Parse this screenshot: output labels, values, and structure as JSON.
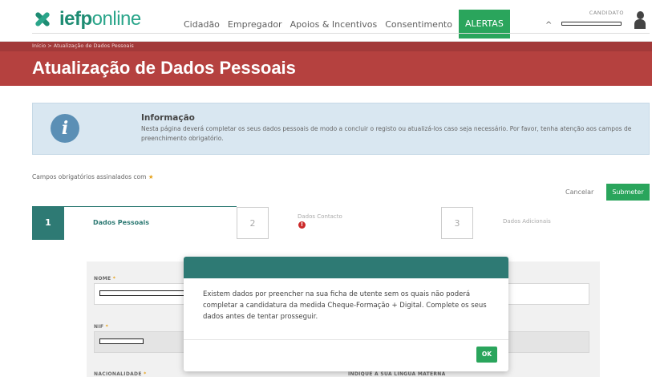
{
  "header": {
    "logo_bold": "iefp",
    "logo_light": "online",
    "nav": [
      "Cidadão",
      "Empregador",
      "Apoios & Incentivos",
      "Consentimento"
    ],
    "alert_label": "ALERTAS",
    "candidate_label": "CANDIDATO"
  },
  "breadcrumb": "Início > Atualização de Dados Pessoais",
  "page_title": "Atualização de Dados Pessoais",
  "info": {
    "heading": "Informação",
    "text": "Nesta página deverá completar os seus dados pessoais de modo a concluir o registo ou atualizá-los caso seja necessário. Por favor, tenha atenção aos campos de preenchimento obrigatório."
  },
  "required_note": "Campos obrigatórios assinalados com",
  "actions": {
    "cancel": "Cancelar",
    "submit": "Submeter"
  },
  "steps": [
    {
      "number": "1",
      "label": "Dados Pessoais"
    },
    {
      "number": "2",
      "label": "Dados Contacto"
    },
    {
      "number": "3",
      "label": "Dados Adicionais"
    }
  ],
  "form": {
    "nome_label": "NOME",
    "nif_label": "NIF",
    "nacionalidade_label": "NACIONALIDADE",
    "lingua_label": "INDIQUE A SUA LÍNGUA MATERNA"
  },
  "modal": {
    "message": "Existem dados por preencher na sua ficha de utente sem os quais não poderá completar a candidatura da medida Cheque-Formação + Digital. Complete os seus dados antes de tentar prosseguir.",
    "ok": "OK"
  },
  "colors": {
    "brand_green": "#2aa55c",
    "teal": "#2e7a74",
    "title_red": "#b5413f",
    "info_blue": "#d9e7f1"
  }
}
